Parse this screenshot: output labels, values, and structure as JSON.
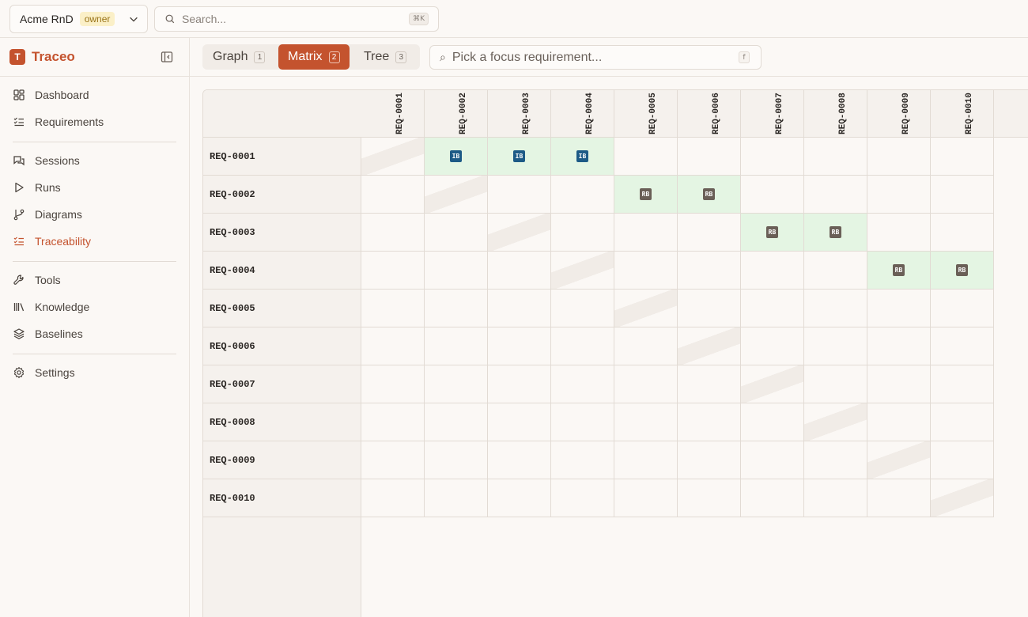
{
  "topbar": {
    "org_name": "Acme RnD",
    "org_role": "owner",
    "search_placeholder": "Search...",
    "search_shortcut": "⌘K"
  },
  "sidebar": {
    "brand_letter": "T",
    "brand_name": "Traceo",
    "items": [
      {
        "label": "Dashboard",
        "icon": "dashboard-icon"
      },
      {
        "label": "Requirements",
        "icon": "list-check-icon"
      },
      {
        "label": "Sessions",
        "icon": "chat-icon"
      },
      {
        "label": "Runs",
        "icon": "play-icon"
      },
      {
        "label": "Diagrams",
        "icon": "branch-icon"
      },
      {
        "label": "Traceability",
        "icon": "list-check-icon",
        "active": true
      },
      {
        "label": "Tools",
        "icon": "wrench-icon"
      },
      {
        "label": "Knowledge",
        "icon": "library-icon"
      },
      {
        "label": "Baselines",
        "icon": "layers-icon"
      },
      {
        "label": "Settings",
        "icon": "gear-icon"
      }
    ]
  },
  "view": {
    "tabs": [
      {
        "label": "Graph",
        "key": "1"
      },
      {
        "label": "Matrix",
        "key": "2",
        "active": true
      },
      {
        "label": "Tree",
        "key": "3"
      }
    ],
    "focus_placeholder": "Pick a focus requirement...",
    "focus_icon": "⌕",
    "focus_shortcut": "f"
  },
  "matrix": {
    "columns": [
      "REQ-0001",
      "REQ-0002",
      "REQ-0003",
      "REQ-0004",
      "REQ-0005",
      "REQ-0006",
      "REQ-0007",
      "REQ-0008",
      "REQ-0009",
      "REQ-0010"
    ],
    "rows": [
      "REQ-0001",
      "REQ-0002",
      "REQ-0003",
      "REQ-0004",
      "REQ-0005",
      "REQ-0006",
      "REQ-0007",
      "REQ-0008",
      "REQ-0009",
      "REQ-0010"
    ],
    "links": [
      {
        "row": 0,
        "col": 1,
        "type": "IB"
      },
      {
        "row": 0,
        "col": 2,
        "type": "IB"
      },
      {
        "row": 0,
        "col": 3,
        "type": "IB"
      },
      {
        "row": 1,
        "col": 4,
        "type": "RB"
      },
      {
        "row": 1,
        "col": 5,
        "type": "RB"
      },
      {
        "row": 2,
        "col": 6,
        "type": "RB"
      },
      {
        "row": 2,
        "col": 7,
        "type": "RB"
      },
      {
        "row": 3,
        "col": 8,
        "type": "RB"
      },
      {
        "row": 3,
        "col": 9,
        "type": "RB"
      }
    ],
    "colors": {
      "IB": "#1d5a86",
      "RB": "#6a5f57",
      "linked": "#e4f5e3",
      "accent": "#c4532e"
    }
  }
}
